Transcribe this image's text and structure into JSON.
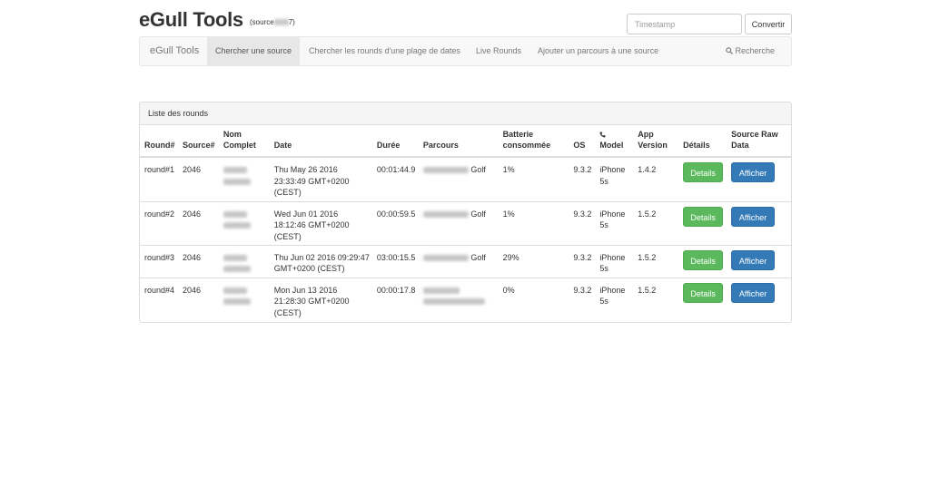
{
  "header": {
    "title": "eGull Tools",
    "subtitle_prefix": "(source",
    "subtitle_suffix": "7)",
    "timestamp_placeholder": "Timestamp",
    "convert_label": "Convertir"
  },
  "nav": {
    "brand": "eGull Tools",
    "items": [
      {
        "label": "Chercher une source",
        "active": true
      },
      {
        "label": "Chercher les rounds d'une plage de dates",
        "active": false
      },
      {
        "label": "Live Rounds",
        "active": false
      },
      {
        "label": "Ajouter un parcours à une source",
        "active": false
      }
    ],
    "search_label": "Recherche"
  },
  "panel": {
    "title": "Liste des rounds",
    "columns": [
      "Round#",
      "Source#",
      "Nom Complet",
      "Date",
      "Durée",
      "Parcours",
      "Batterie consommée",
      "OS",
      "Model",
      "App Version",
      "Détails",
      "Source Raw Data"
    ],
    "rows": [
      {
        "round": "round#1",
        "source": "2046",
        "date": [
          "Thu May 26 2016",
          "23:33:49 GMT+0200",
          "(CEST)"
        ],
        "duree": "00:01:44.9",
        "parcours_suffix": "Golf",
        "batterie": "1%",
        "os": "9.3.2",
        "model": [
          "iPhone",
          "5s"
        ],
        "app": "1.4.2",
        "details_label": "Details",
        "afficher_label": "Afficher"
      },
      {
        "round": "round#2",
        "source": "2046",
        "date": [
          "Wed Jun 01 2016",
          "18:12:46 GMT+0200",
          "(CEST)"
        ],
        "duree": "00:00:59.5",
        "parcours_suffix": "Golf",
        "batterie": "1%",
        "os": "9.3.2",
        "model": [
          "iPhone",
          "5s"
        ],
        "app": "1.5.2",
        "details_label": "Details",
        "afficher_label": "Afficher"
      },
      {
        "round": "round#3",
        "source": "2046",
        "date": [
          "Thu Jun 02 2016 09:29:47",
          "GMT+0200 (CEST)"
        ],
        "duree": "03:00:15.5",
        "parcours_suffix": "Golf",
        "batterie": "29%",
        "os": "9.3.2",
        "model": [
          "iPhone",
          "5s"
        ],
        "app": "1.5.2",
        "details_label": "Details",
        "afficher_label": "Afficher"
      },
      {
        "round": "round#4",
        "source": "2046",
        "date": [
          "Mon Jun 13 2016",
          "21:28:30 GMT+0200",
          "(CEST)"
        ],
        "duree": "00:00:17.8",
        "parcours_suffix": "",
        "batterie": "0%",
        "os": "9.3.2",
        "model": [
          "iPhone",
          "5s"
        ],
        "app": "1.5.2",
        "details_label": "Details",
        "afficher_label": "Afficher"
      }
    ]
  },
  "colors": {
    "success": "#5cb85c",
    "primary": "#337ab7",
    "navbar_bg": "#f8f8f8",
    "nav_active_bg": "#e7e7e7"
  }
}
